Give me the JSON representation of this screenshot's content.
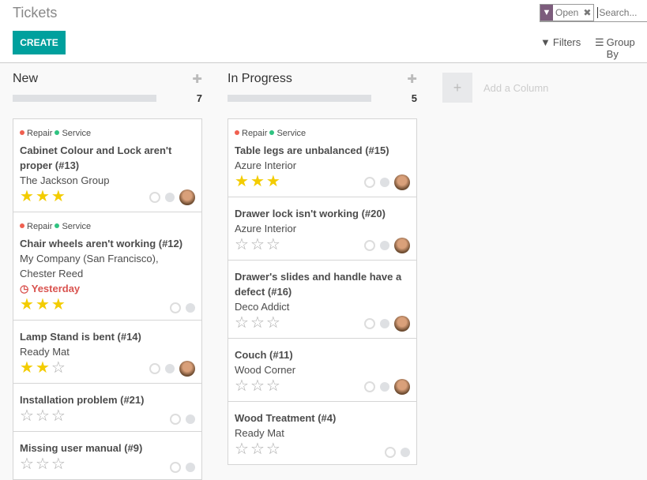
{
  "header": {
    "title": "Tickets",
    "create_label": "CREATE",
    "filters_label": "Filters",
    "groupby_label": "Group By",
    "search": {
      "facet": "Open",
      "placeholder": "Search..."
    }
  },
  "add_column_label": "Add a Column",
  "colors": {
    "accent": "#00a09d",
    "facet": "#7c5c7c",
    "repair_tag": "#f06050",
    "service_tag": "#30c381",
    "deadline": "#d9534f",
    "star": "#f3cc00"
  },
  "columns": [
    {
      "name": "New",
      "count": "7",
      "cards": [
        {
          "tags": [
            "Repair",
            "Service"
          ],
          "title": "Cabinet Colour and Lock aren't proper (#13)",
          "customer": "The Jackson Group",
          "stars": 3,
          "avatar": true
        },
        {
          "tags": [
            "Repair",
            "Service"
          ],
          "title": "Chair wheels aren't working (#12)",
          "customer": "My Company (San Francisco), Chester Reed",
          "deadline": "Yesterday",
          "stars": 3,
          "avatar": false
        },
        {
          "tags": [],
          "title": "Lamp Stand is bent (#14)",
          "customer": "Ready Mat",
          "stars": 2,
          "avatar": true
        },
        {
          "tags": [],
          "title": "Installation problem (#21)",
          "customer": "",
          "stars": 0,
          "avatar": false
        },
        {
          "tags": [],
          "title": "Missing user manual (#9)",
          "customer": "",
          "stars": 0,
          "avatar": false
        }
      ]
    },
    {
      "name": "In Progress",
      "count": "5",
      "cards": [
        {
          "tags": [
            "Repair",
            "Service"
          ],
          "title": "Table legs are unbalanced (#15)",
          "customer": "Azure Interior",
          "stars": 3,
          "avatar": true
        },
        {
          "tags": [],
          "title": "Drawer lock isn't working (#20)",
          "customer": "Azure Interior",
          "stars": 0,
          "avatar": true
        },
        {
          "tags": [],
          "title": "Drawer's slides and handle have a defect (#16)",
          "customer": "Deco Addict",
          "stars": 0,
          "avatar": true
        },
        {
          "tags": [],
          "title": "Couch (#11)",
          "customer": "Wood Corner",
          "stars": 0,
          "avatar": true
        },
        {
          "tags": [],
          "title": "Wood Treatment (#4)",
          "customer": "Ready Mat",
          "stars": 0,
          "avatar": false
        }
      ]
    }
  ]
}
